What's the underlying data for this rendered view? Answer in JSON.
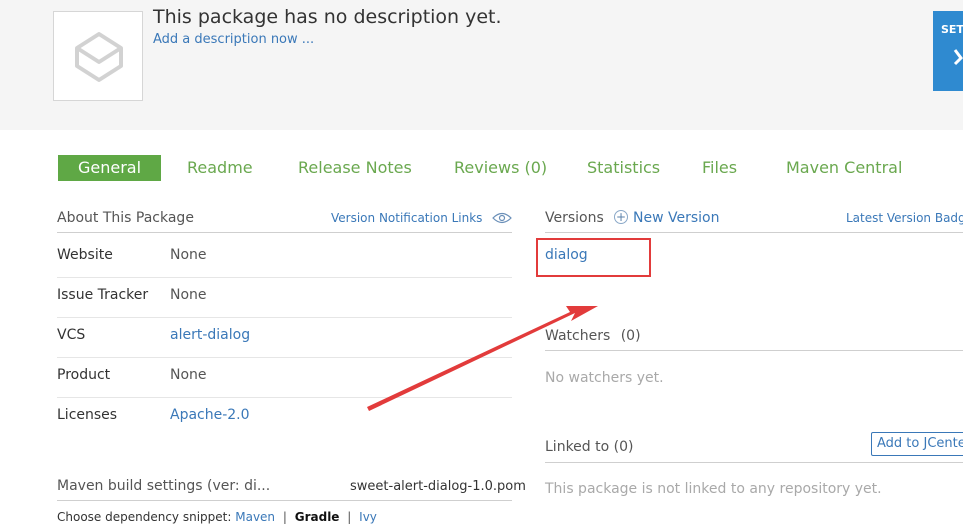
{
  "header": {
    "description": "This package has no description yet.",
    "add_description": "Add a description now ...",
    "set_button_label": "SET",
    "package_icon": "package-box-icon"
  },
  "tabs": [
    {
      "label": "General",
      "active": true
    },
    {
      "label": "Readme",
      "active": false
    },
    {
      "label": "Release Notes",
      "active": false
    },
    {
      "label": "Reviews (0)",
      "active": false
    },
    {
      "label": "Statistics",
      "active": false
    },
    {
      "label": "Files",
      "active": false
    },
    {
      "label": "Maven Central",
      "active": false
    }
  ],
  "about": {
    "title": "About This Package",
    "notification_links": "Version Notification Links",
    "rows": [
      {
        "label": "Website",
        "value": "None"
      },
      {
        "label": "Issue Tracker",
        "value": "None"
      },
      {
        "label": "VCS",
        "value": "alert-dialog"
      },
      {
        "label": "Product",
        "value": "None"
      },
      {
        "label": "Licenses",
        "value": "Apache-2.0"
      }
    ]
  },
  "maven": {
    "title": "Maven build settings (ver: di...",
    "pom": "sweet-alert-dialog-1.0.pom",
    "snippet_label": "Choose dependency snippet:",
    "options": [
      "Maven",
      "Gradle",
      "Ivy"
    ],
    "separator": "|"
  },
  "versions": {
    "title": "Versions",
    "new_version": "New Version",
    "plus_glyph": "+",
    "badge_link": "Latest Version Badge",
    "items": [
      "dialog"
    ]
  },
  "watchers": {
    "title": "Watchers",
    "count": "(0)",
    "empty": "No watchers yet."
  },
  "linked": {
    "title": "Linked to (0)",
    "add_button": "Add to JCenter",
    "empty": "This package is not linked to any repository yet."
  },
  "colors": {
    "accent_green": "#5fa845",
    "link_blue": "#3a78b8",
    "highlight_red": "#e23b3b",
    "set_blue": "#2f8ad0"
  }
}
